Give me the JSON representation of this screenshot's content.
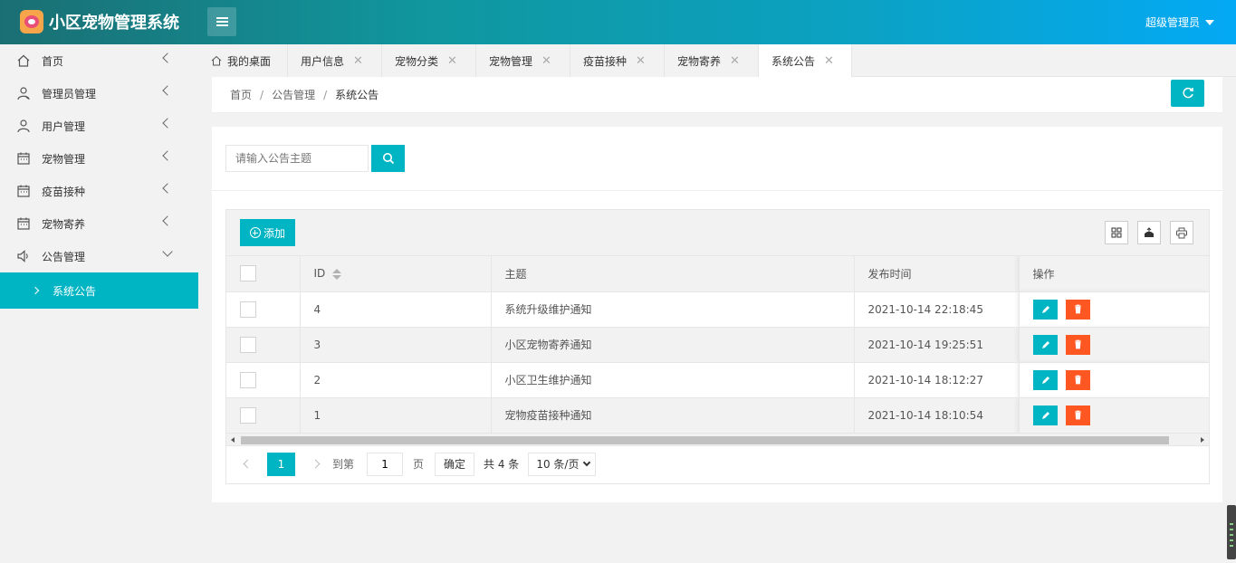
{
  "header": {
    "app_title": "小区宠物管理系统",
    "user_name": "超级管理员"
  },
  "sidebar": {
    "items": [
      {
        "label": "首页"
      },
      {
        "label": "管理员管理"
      },
      {
        "label": "用户管理"
      },
      {
        "label": "宠物管理"
      },
      {
        "label": "疫苗接种"
      },
      {
        "label": "宠物寄养"
      },
      {
        "label": "公告管理"
      }
    ],
    "sub_active": "系统公告"
  },
  "tabs": [
    {
      "label": "我的桌面"
    },
    {
      "label": "用户信息"
    },
    {
      "label": "宠物分类"
    },
    {
      "label": "宠物管理"
    },
    {
      "label": "疫苗接种"
    },
    {
      "label": "宠物寄养"
    },
    {
      "label": "系统公告"
    }
  ],
  "breadcrumb": [
    "首页",
    "公告管理",
    "系统公告"
  ],
  "search": {
    "placeholder": "请输入公告主题"
  },
  "toolbar": {
    "add_label": "添加"
  },
  "table": {
    "columns": [
      "ID",
      "主题",
      "发布时间",
      "操作"
    ],
    "rows": [
      {
        "id": "4",
        "title": "系统升级维护通知",
        "time": "2021-10-14 22:18:45"
      },
      {
        "id": "3",
        "title": "小区宠物寄养通知",
        "time": "2021-10-14 19:25:51"
      },
      {
        "id": "2",
        "title": "小区卫生维护通知",
        "time": "2021-10-14 18:12:27"
      },
      {
        "id": "1",
        "title": "宠物疫苗接种通知",
        "time": "2021-10-14 18:10:54"
      }
    ]
  },
  "pager": {
    "current": "1",
    "goto_label": "到第",
    "goto_value": "1",
    "page_label": "页",
    "confirm_label": "确定",
    "total_label": "共 4 条",
    "page_size": "10 条/页"
  },
  "colors": {
    "accent": "#00b5c3",
    "danger": "#ff5722"
  }
}
